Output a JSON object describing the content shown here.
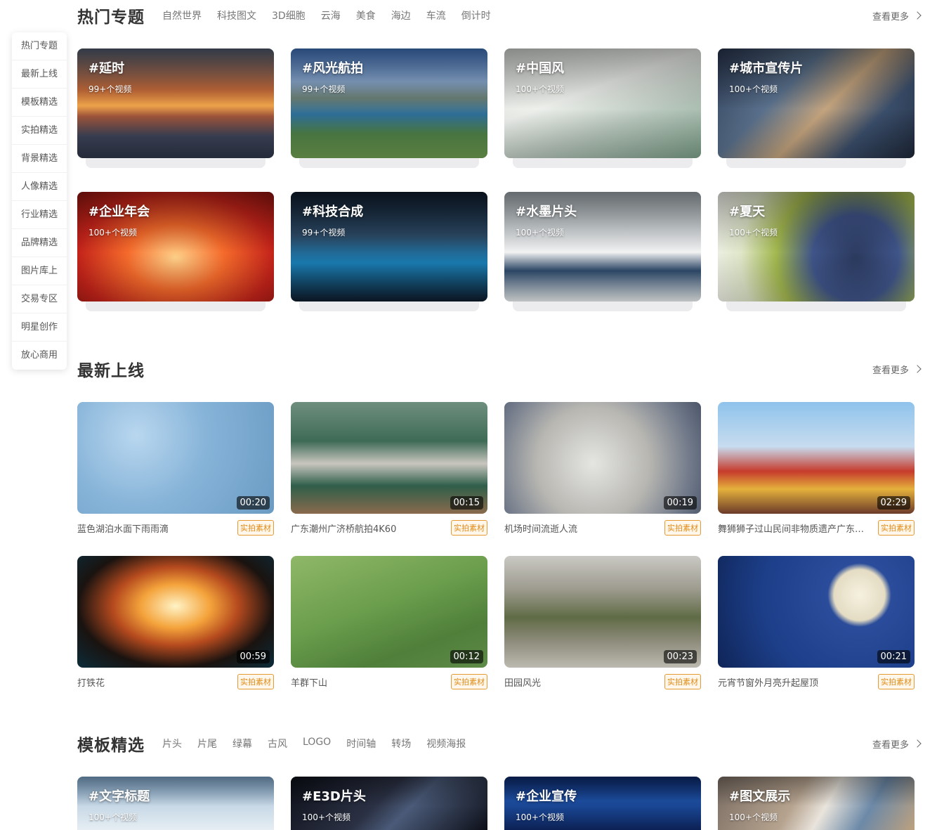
{
  "sidenav": [
    "热门专题",
    "最新上线",
    "模板精选",
    "实拍精选",
    "背景精选",
    "人像精选",
    "行业精选",
    "品牌精选",
    "图片库上",
    "交易专区",
    "明星创作",
    "放心商用"
  ],
  "sections": {
    "hot": {
      "title": "热门专题",
      "tabs": [
        "自然世界",
        "科技图文",
        "3D细胞",
        "云海",
        "美食",
        "海边",
        "车流",
        "倒计时"
      ],
      "more": "查看更多",
      "cards": [
        {
          "name": "#延时",
          "count": "99+个视频"
        },
        {
          "name": "#风光航拍",
          "count": "99+个视频"
        },
        {
          "name": "#中国风",
          "count": "100+个视频"
        },
        {
          "name": "#城市宣传片",
          "count": "100+个视频"
        },
        {
          "name": "#企业年会",
          "count": "100+个视频"
        },
        {
          "name": "#科技合成",
          "count": "99+个视频"
        },
        {
          "name": "#水墨片头",
          "count": "100+个视频"
        },
        {
          "name": "#夏天",
          "count": "100+个视频"
        }
      ]
    },
    "latest": {
      "title": "最新上线",
      "more": "查看更多",
      "videos": [
        {
          "title": "蓝色湖泊水面下雨雨滴",
          "duration": "00:20",
          "badge": "实拍素材"
        },
        {
          "title": "广东潮州广济桥航拍4K60",
          "duration": "00:15",
          "badge": "实拍素材"
        },
        {
          "title": "机场时间流逝人流",
          "duration": "00:19",
          "badge": "实拍素材"
        },
        {
          "title": "舞狮狮子过山民间非物质遗产广东传统文化",
          "duration": "02:29",
          "badge": "实拍素材"
        },
        {
          "title": "打铁花",
          "duration": "00:59",
          "badge": "实拍素材"
        },
        {
          "title": "羊群下山",
          "duration": "00:12",
          "badge": "实拍素材"
        },
        {
          "title": "田园风光",
          "duration": "00:23",
          "badge": "实拍素材"
        },
        {
          "title": "元宵节窗外月亮升起屋顶",
          "duration": "00:21",
          "badge": "实拍素材"
        }
      ]
    },
    "templates": {
      "title": "模板精选",
      "tabs": [
        "片头",
        "片尾",
        "绿幕",
        "古风",
        "LOGO",
        "时间轴",
        "转场",
        "视频海报"
      ],
      "more": "查看更多",
      "cards": [
        {
          "name": "#文字标题",
          "count": "100+个视频"
        },
        {
          "name": "#E3D片头",
          "count": "100+个视频"
        },
        {
          "name": "#企业宣传",
          "count": "100+个视频"
        },
        {
          "name": "#图文展示",
          "count": "100+个视频"
        }
      ]
    }
  }
}
